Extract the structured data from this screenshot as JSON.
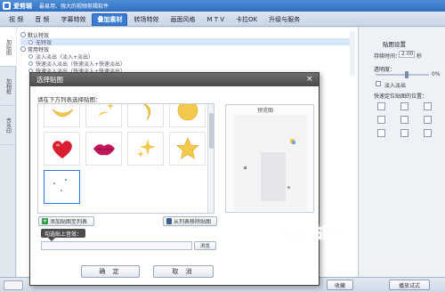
{
  "app": {
    "name": "爱剪辑",
    "slogan": "最易用、强大的视频剪辑软件"
  },
  "tabs": [
    {
      "label": "视  频",
      "active": false
    },
    {
      "label": "音  频",
      "active": false
    },
    {
      "label": "字幕特效",
      "active": false
    },
    {
      "label": "叠加素材",
      "active": true
    },
    {
      "label": "转场特效",
      "active": false
    },
    {
      "label": "画面风格",
      "active": false
    },
    {
      "label": "M T V",
      "active": false
    },
    {
      "label": "卡拉OK",
      "active": false
    },
    {
      "label": "升级与服务",
      "active": false
    }
  ],
  "side_tabs": [
    {
      "label": "加贴图",
      "active": true
    },
    {
      "label": "加相框",
      "active": false
    },
    {
      "label": "去水印",
      "active": false
    }
  ],
  "effects": {
    "group1": "默认特效",
    "group1_item": "无特效",
    "group2": "常用特效",
    "group2_items": [
      "淡入淡出（淡入+淡出）",
      "快速淡入淡出（快速淡入+快速淡出）",
      "快速淡入淡出（快速淡入+快速淡出）"
    ]
  },
  "settings": {
    "title": "贴图设置",
    "duration_label": "持续时间：",
    "duration_value": "2.00",
    "duration_unit": "秒",
    "opacity_label": "透明度：",
    "opacity_value": "0%",
    "fade_label": "淡入淡出",
    "position_label": "快速定位贴图的位置："
  },
  "dialog": {
    "title": "选择贴图",
    "close": "×",
    "prompt": "请在下方列表选择贴图：",
    "preview_label": "预览图",
    "add_label": "添加贴图至列表",
    "remove_label": "从列表移除贴图",
    "tooltip": "勾选贴上音效：",
    "browse_label": "浏览",
    "ok_label": "确 定",
    "cancel_label": "取 消"
  },
  "stickers": [
    {
      "name": "moon-icon"
    },
    {
      "name": "sparkles-icon"
    },
    {
      "name": "moon-icon"
    },
    {
      "name": "moon-icon"
    },
    {
      "name": "heart-icon"
    },
    {
      "name": "lips-icon"
    },
    {
      "name": "stars-icon"
    },
    {
      "name": "star-icon"
    },
    {
      "name": "custom-sticker",
      "selected": true
    }
  ],
  "bottom": {
    "collect_label": "收藏",
    "preview_label": "播放试式"
  },
  "caption": "添加贴图",
  "colors": {
    "accent": "#3a7bd5",
    "caption": "#e8348c",
    "heart": "#d81e2f",
    "star": "#f2c94c"
  }
}
